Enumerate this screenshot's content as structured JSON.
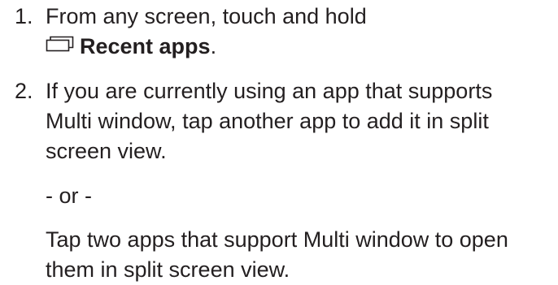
{
  "steps": [
    {
      "number": "1.",
      "text_before": "From any screen, touch and hold",
      "icon": "recent-apps-icon",
      "bold_label": "Recent apps",
      "text_after": "."
    },
    {
      "number": "2.",
      "text_lines": [
        "If you are currently using an app that supports",
        "Multi window, tap another app to add it in split",
        "screen view."
      ],
      "separator": "- or -",
      "alt_lines": [
        "Tap two apps that support Multi window to open",
        "them in split screen view."
      ]
    }
  ],
  "colors": {
    "text": "#231f20",
    "icon_stroke": "#231f20"
  }
}
